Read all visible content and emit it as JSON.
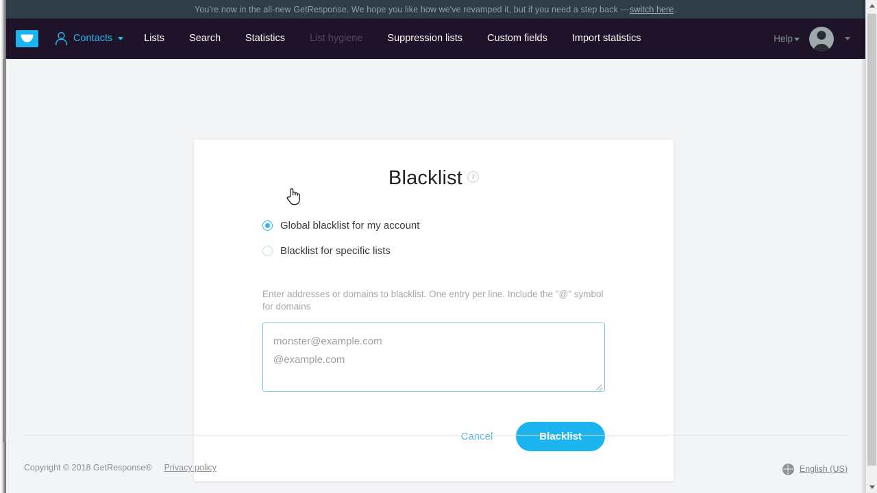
{
  "banner": {
    "text_before": "You're now in the all-new GetResponse. We hope you like how we've revamped it, but if you need a step back — ",
    "link": "switch here",
    "text_after": "."
  },
  "navbar": {
    "logo_icon": "envelope-logo-icon",
    "contacts_icon": "person-icon",
    "items": [
      {
        "label": "Contacts",
        "state": "active",
        "has_caret": true
      },
      {
        "label": "Lists",
        "state": "normal",
        "has_caret": false
      },
      {
        "label": "Search",
        "state": "normal",
        "has_caret": false
      },
      {
        "label": "Statistics",
        "state": "normal",
        "has_caret": false
      },
      {
        "label": "List hygiene",
        "state": "muted",
        "has_caret": false
      },
      {
        "label": "Suppression lists",
        "state": "normal",
        "has_caret": false
      },
      {
        "label": "Custom fields",
        "state": "normal",
        "has_caret": false
      },
      {
        "label": "Import statistics",
        "state": "normal",
        "has_caret": false
      }
    ],
    "help_label": "Help",
    "avatar_icon": "user-avatar-icon",
    "accent_color": "#29b6f0",
    "background_color": "#1f1329"
  },
  "card": {
    "title": "Blacklist",
    "info_icon_glyph": "i",
    "radios": [
      {
        "label": "Global blacklist for my account",
        "checked": true
      },
      {
        "label": "Blacklist for specific lists",
        "checked": false
      }
    ],
    "field_help": "Enter addresses or domains to blacklist. One entry per line. Include the \"@\" symbol for domains",
    "textarea": {
      "value": "",
      "placeholder_line1": "monster@example.com",
      "placeholder_line2": "@example.com"
    },
    "cancel_label": "Cancel",
    "submit_label": "Blacklist",
    "primary_color": "#1cb4ef"
  },
  "footer": {
    "copyright": "Copyright © 2018 GetResponse®",
    "privacy_link": "Privacy policy",
    "language": "English (US)",
    "globe_icon": "globe-icon"
  }
}
